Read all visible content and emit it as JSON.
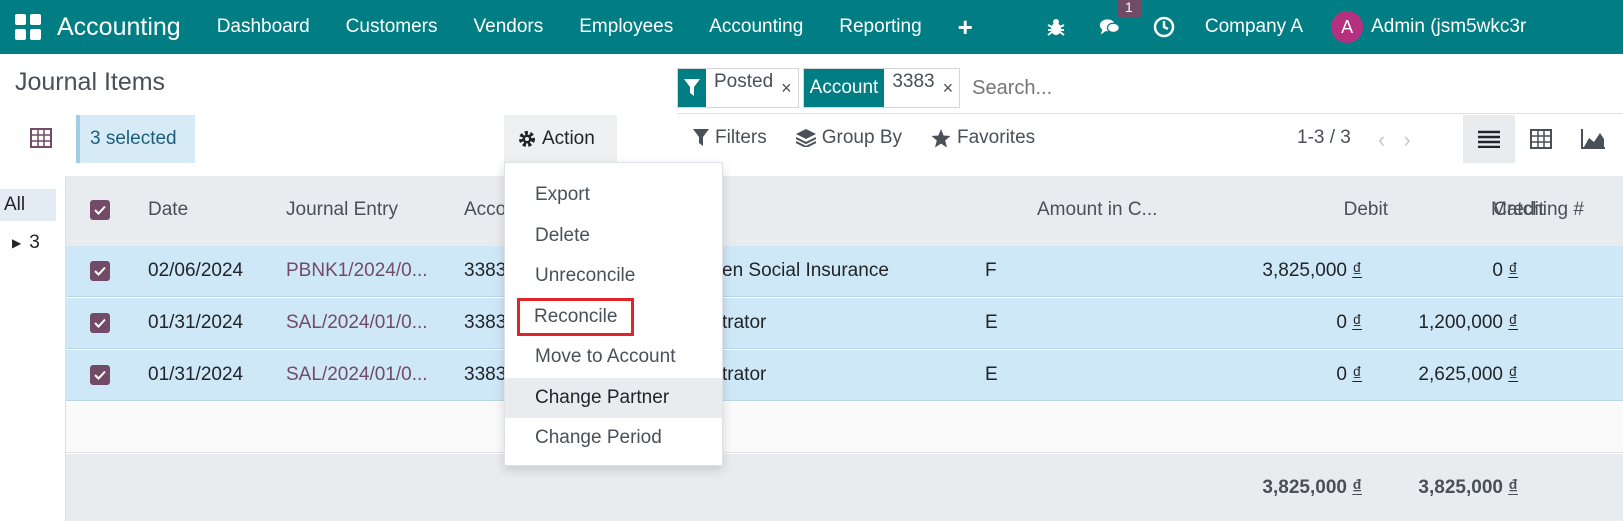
{
  "navbar": {
    "brand": "Accounting",
    "menu": [
      "Dashboard",
      "Customers",
      "Vendors",
      "Employees",
      "Accounting",
      "Reporting"
    ],
    "plus": "+",
    "message_count": "1",
    "company": "Company A",
    "avatar_letter": "A",
    "user": "Admin (jsm5wkc3r"
  },
  "page": {
    "title": "Journal Items"
  },
  "search": {
    "facets": [
      {
        "label_icon": "filter-icon",
        "value": "Posted"
      },
      {
        "label": "Account",
        "value": "3383"
      }
    ],
    "close_glyph": "×",
    "placeholder": "Search..."
  },
  "selection": {
    "text": "3 selected"
  },
  "action": {
    "label": "Action"
  },
  "tools": {
    "filters": "Filters",
    "group_by": "Group By",
    "favorites": "Favorites"
  },
  "pager": {
    "text": "1-3 / 3",
    "prev": "‹",
    "next": "›"
  },
  "side_panel": {
    "all": "All",
    "group": "3"
  },
  "table": {
    "headers": {
      "date": "Date",
      "journal_entry": "Journal Entry",
      "account": "Acco",
      "amount_currency": "Amount in C...",
      "debit": "Debit",
      "credit": "Credit",
      "matching": "Matching #"
    },
    "rows": [
      {
        "date": "02/06/2024",
        "journal_entry": "PBNK1/2024/0...",
        "account": "3383",
        "label": "en Social Insurance",
        "ref": "F",
        "debit": "3,825,000",
        "credit": "0"
      },
      {
        "date": "01/31/2024",
        "journal_entry": "SAL/2024/01/0...",
        "account": "3383",
        "label": "trator",
        "ref": "E",
        "debit": "0",
        "credit": "1,200,000"
      },
      {
        "date": "01/31/2024",
        "journal_entry": "SAL/2024/01/0...",
        "account": "3383",
        "label": "trator",
        "ref": "E",
        "debit": "0",
        "credit": "2,625,000"
      }
    ],
    "currency": "₫",
    "totals": {
      "debit": "3,825,000",
      "credit": "3,825,000"
    }
  },
  "dropdown": {
    "items": [
      "Export",
      "Delete",
      "Unreconcile",
      "Reconcile",
      "Move to Account",
      "Change Partner",
      "Change Period"
    ],
    "highlighted": "Reconcile",
    "hovered": "Change Partner"
  },
  "colors": {
    "navbar": "#017e84",
    "primary": "#714b67",
    "selected_row": "#cfe8f7",
    "highlight": "#e0242b"
  }
}
